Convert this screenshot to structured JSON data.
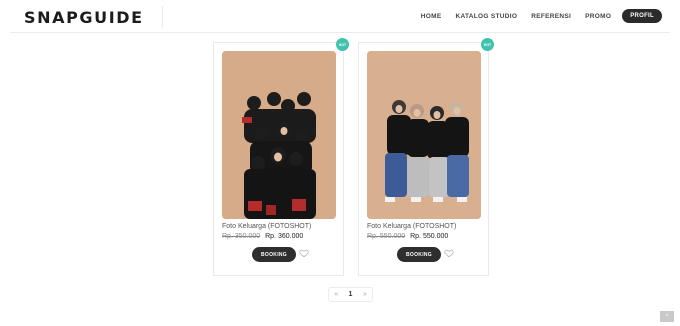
{
  "header": {
    "logo": "SNAPGUIDE",
    "nav": [
      "HOME",
      "KATALOG STUDIO",
      "REFERENSI",
      "PROMO"
    ],
    "profile_label": "PROFIL"
  },
  "products": [
    {
      "badge": "HOT",
      "title": "Foto Keluarga (FOTOSHOT)",
      "old_price": "Rp. 350.000",
      "new_price": "Rp. 360.000",
      "booking_label": "BOOKING"
    },
    {
      "badge": "HOT",
      "title": "Foto Keluarga (FOTOSHOT)",
      "old_price": "Rp. 550.000",
      "new_price": "Rp. 550.000",
      "booking_label": "BOOKING"
    }
  ],
  "pagination": {
    "prev": "«",
    "current": "1",
    "next": "»"
  },
  "scroll_top_icon": "^",
  "colors": {
    "badge": "#3fc3ae",
    "button": "#2e2e2e",
    "photo_backdrop": "#d4a888"
  }
}
